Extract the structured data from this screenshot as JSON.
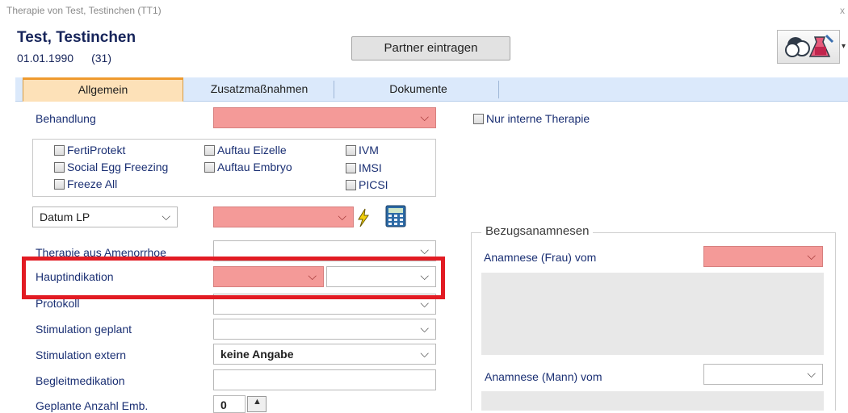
{
  "window": {
    "title": "Therapie von Test, Testinchen (TT1)",
    "close_glyph": "x"
  },
  "patient": {
    "name": "Test, Testinchen",
    "dob": "01.01.1990",
    "age": "(31)"
  },
  "toolbar": {
    "partner_button": "Partner eintragen",
    "dropdown_arrow": "▾"
  },
  "tabs": [
    {
      "label": "Allgemein",
      "active": true
    },
    {
      "label": "Zusatzmaßnahmen",
      "active": false
    },
    {
      "label": "Dokumente",
      "active": false
    }
  ],
  "form": {
    "behandlung_label": "Behandlung",
    "nur_interne_label": "Nur interne Therapie",
    "checkboxes": {
      "fertiprotekt": "FertiProtekt",
      "social_egg": "Social Egg Freezing",
      "freeze_all": "Freeze All",
      "auftau_eizelle": "Auftau Eizelle",
      "auftau_embryo": "Auftau Embryo",
      "ivm": "IVM",
      "imsi": "IMSI",
      "picsi": "PICSI"
    },
    "datum_select": "Datum LP",
    "therapie_amenorrhoe_label": "Therapie aus Amenorrhoe",
    "hauptindikation_label": "Hauptindikation",
    "protokoll_label": "Protokoll",
    "stimulation_geplant_label": "Stimulation geplant",
    "stimulation_extern_label": "Stimulation extern",
    "stimulation_extern_value": "keine Angabe",
    "begleitmedikation_label": "Begleitmedikation",
    "geplante_anzahl_label": "Geplante Anzahl Emb.",
    "geplante_anzahl_value": "0"
  },
  "bezug": {
    "title": "Bezugsanamnesen",
    "frau_label": "Anamnese (Frau) vom",
    "mann_label": "Anamnese (Mann) vom"
  },
  "glyphs": {
    "chevron": "⌵",
    "spin_up": "▲"
  },
  "colors": {
    "required_field": "#f49a98",
    "active_tab": "#fde1b8",
    "tab_strip": "#dbe9fb",
    "highlight": "#e21b23",
    "label": "#1a2f73"
  }
}
